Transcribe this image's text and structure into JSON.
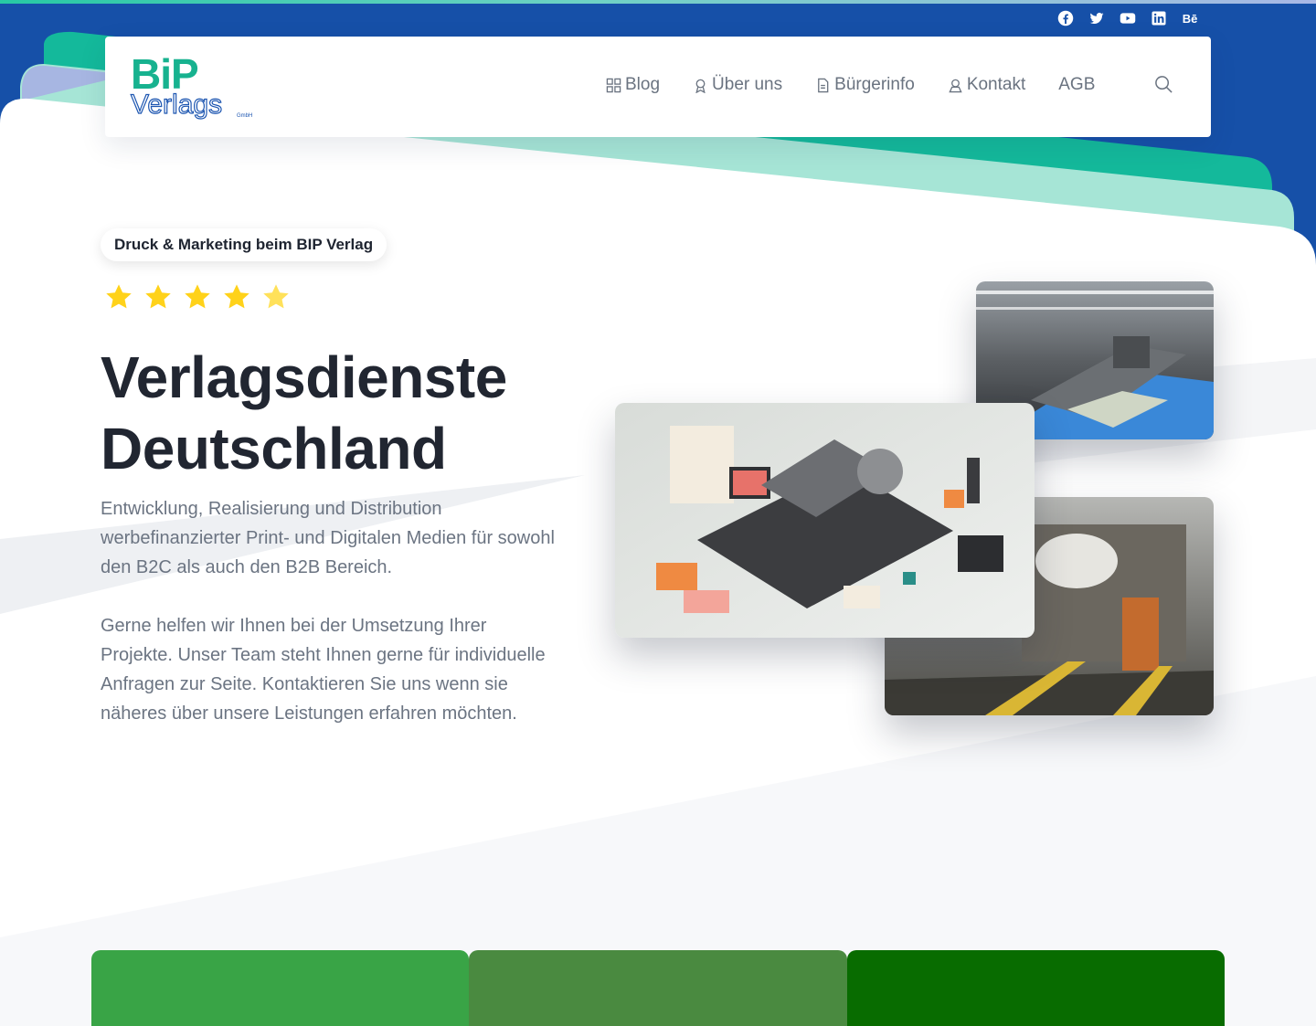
{
  "social": {
    "icons": [
      "facebook-icon",
      "twitter-icon",
      "youtube-icon",
      "linkedin-icon",
      "behance-icon"
    ],
    "behance_label": "Bē"
  },
  "logo": {
    "line1": "BiP",
    "line2": "Verlags",
    "line3": "GmbH"
  },
  "nav": {
    "items": [
      {
        "label": "Blog",
        "icon": "grid-icon"
      },
      {
        "label": "Über uns",
        "icon": "award-icon"
      },
      {
        "label": "Bürgerinfo",
        "icon": "document-icon"
      },
      {
        "label": "Kontakt",
        "icon": "contact-icon"
      },
      {
        "label": "AGB",
        "icon": ""
      }
    ],
    "search_icon": "search-icon"
  },
  "hero": {
    "badge": "Druck & Marketing beim BIP Verlag",
    "rating": 5,
    "title_line1": "Verlagsdienste",
    "title_line2": "Deutschland",
    "paragraph1": "Entwicklung, Realisierung und Distribution werbefinanzierter Print- und Digitalen Medien für sowohl den B2C als auch den B2B Bereich.",
    "paragraph2": "Gerne helfen wir Ihnen bei der Umsetzung Ihrer Projekte. Unser Team steht Ihnen gerne für individuelle Anfragen zur Seite. Kontaktieren Sie uns wenn sie näheres über unsere Leistungen erfahren möchten."
  },
  "colors": {
    "brand_blue": "#1650a8",
    "brand_teal": "#17b28f",
    "star_yellow": "#ffd21a",
    "card_green_1": "#39a446",
    "card_green_2": "#4a8a40",
    "card_green_3": "#086c00"
  }
}
